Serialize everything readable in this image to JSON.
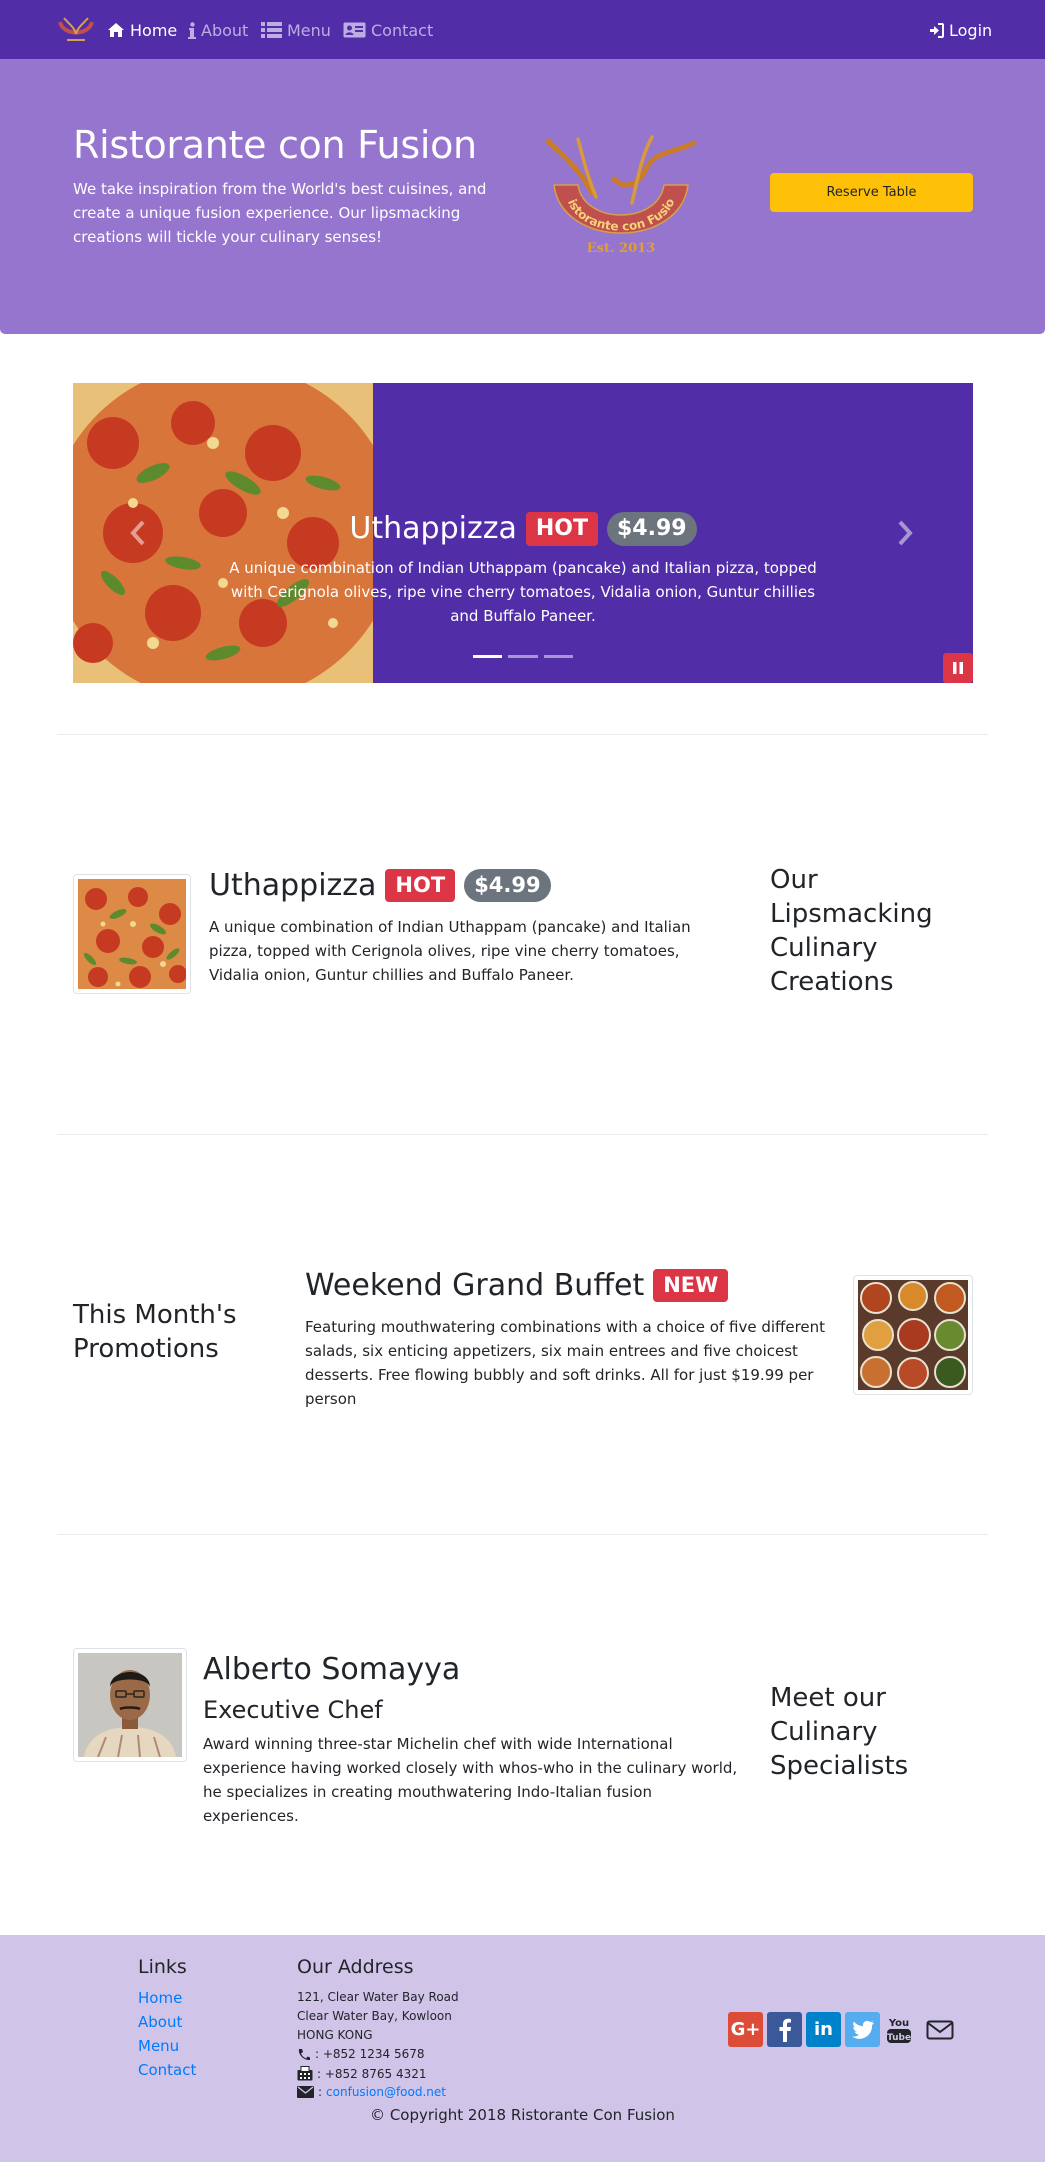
{
  "nav": {
    "items": [
      {
        "label": "Home",
        "icon": "home-icon"
      },
      {
        "label": "About",
        "icon": "info-icon"
      },
      {
        "label": "Menu",
        "icon": "list-icon"
      },
      {
        "label": "Contact",
        "icon": "address-card-icon"
      }
    ],
    "login_label": "Login"
  },
  "jumbotron": {
    "title": "Ristorante con Fusion",
    "text": "We take inspiration from the World's best cuisines, and create a unique fusion experience. Our lipsmacking creations will tickle your culinary senses!",
    "logo_text": "Ristorante con Fusion",
    "logo_est": "Est. 2013",
    "reserve_label": "Reserve Table"
  },
  "carousel": {
    "dish": "Uthappizza",
    "badge": "HOT",
    "price": "$4.99",
    "description": "A unique combination of Indian Uthappam (pancake) and Italian pizza, topped with Cerignola olives, ripe vine cherry tomatoes, Vidalia onion, Guntur chillies and Buffalo Paneer.",
    "slides": 3,
    "active_slide": 0
  },
  "dish": {
    "name": "Uthappizza",
    "badge": "HOT",
    "price": "$4.99",
    "description": "A unique combination of Indian Uthappam (pancake) and Italian pizza, topped with Cerignola olives, ripe vine cherry tomatoes, Vidalia onion, Guntur chillies and Buffalo Paneer.",
    "side_heading": "Our Lipsmacking Culinary Creations"
  },
  "promotion": {
    "side_heading": "This Month's Promotions",
    "name": "Weekend Grand Buffet",
    "badge": "NEW",
    "description": "Featuring mouthwatering combinations with a choice of five different salads, six enticing appetizers, six main entrees and five choicest desserts. Free flowing bubbly and soft drinks. All for just $19.99 per person"
  },
  "leader": {
    "name": "Alberto Somayya",
    "designation": "Executive Chef",
    "description": "Award winning three-star Michelin chef with wide International experience having worked closely with whos-who in the culinary world, he specializes in creating mouthwatering Indo-Italian fusion experiences.",
    "side_heading": "Meet our Culinary Specialists"
  },
  "footer": {
    "links_heading": "Links",
    "links": [
      "Home",
      "About",
      "Menu",
      "Contact"
    ],
    "address_heading": "Our Address",
    "address": [
      "121, Clear Water Bay Road",
      "Clear Water Bay, Kowloon",
      "HONG KONG"
    ],
    "phone": ": +852 1234 5678",
    "fax": ": +852 8765 4321",
    "email": "confusion@food.net",
    "social": [
      "google-plus-icon",
      "facebook-icon",
      "linkedin-icon",
      "twitter-icon",
      "youtube-icon",
      "mail-icon"
    ],
    "copyright": "© Copyright 2018 Ristorante Con Fusion"
  },
  "colors": {
    "primary_dark": "#512da8",
    "primary_light": "#9575cd",
    "footer_bg": "#d1c4e9",
    "warning": "#ffc107",
    "danger": "#dc3545",
    "secondary": "#6c757d"
  }
}
